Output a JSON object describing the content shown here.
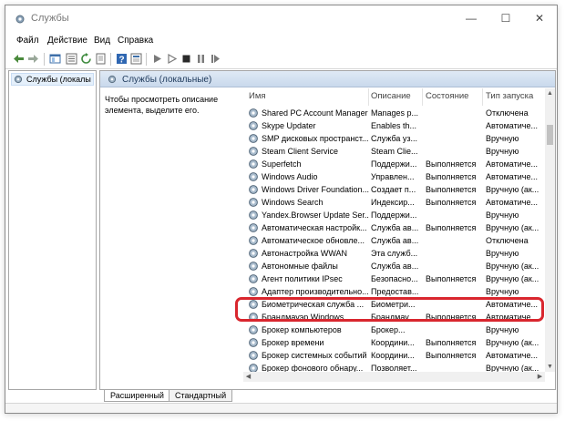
{
  "window": {
    "title": "Службы",
    "controls": {
      "minimize": "—",
      "maximize": "☐",
      "close": "✕"
    }
  },
  "menu": [
    "Файл",
    "Действие",
    "Вид",
    "Справка"
  ],
  "toolbar": {
    "icons": [
      "back-arrow-icon",
      "forward-arrow-icon",
      "console-tree-icon",
      "list-icon",
      "refresh-icon",
      "export-list-icon",
      "help-icon",
      "properties-icon",
      "play-icon",
      "play-outline-icon",
      "stop-icon",
      "pause-icon",
      "restart-icon"
    ]
  },
  "tree": {
    "item_label": "Службы (локалы"
  },
  "panel": {
    "header": "Службы (локальные)",
    "description": "Чтобы просмотреть описание элемента, выделите его."
  },
  "table": {
    "columns": [
      "Имя",
      "Описание",
      "Состояние",
      "Тип запуска"
    ],
    "rows": [
      {
        "name": "Shared PC Account Manager",
        "desc": "Manages p...",
        "state": "",
        "start": "Отключена"
      },
      {
        "name": "Skype Updater",
        "desc": "Enables th...",
        "state": "",
        "start": "Автоматиче..."
      },
      {
        "name": "SMP дисковых пространст...",
        "desc": "Служба уз...",
        "state": "",
        "start": "Вручную"
      },
      {
        "name": "Steam Client Service",
        "desc": "Steam Clie...",
        "state": "",
        "start": "Вручную"
      },
      {
        "name": "Superfetch",
        "desc": "Поддержи...",
        "state": "Выполняется",
        "start": "Автоматиче..."
      },
      {
        "name": "Windows Audio",
        "desc": "Управлен...",
        "state": "Выполняется",
        "start": "Автоматиче..."
      },
      {
        "name": "Windows Driver Foundation...",
        "desc": "Создает п...",
        "state": "Выполняется",
        "start": "Вручную (ак..."
      },
      {
        "name": "Windows Search",
        "desc": "Индексир...",
        "state": "Выполняется",
        "start": "Автоматиче..."
      },
      {
        "name": "Yandex.Browser Update Ser...",
        "desc": "Поддержи...",
        "state": "",
        "start": "Вручную"
      },
      {
        "name": "Автоматическая настройк...",
        "desc": "Служба ав...",
        "state": "Выполняется",
        "start": "Вручную (ак..."
      },
      {
        "name": "Автоматическое обновле...",
        "desc": "Служба ав...",
        "state": "",
        "start": "Отключена"
      },
      {
        "name": "Автонастройка WWAN",
        "desc": "Эта служб...",
        "state": "",
        "start": "Вручную"
      },
      {
        "name": "Автономные файлы",
        "desc": "Служба ав...",
        "state": "",
        "start": "Вручную (ак..."
      },
      {
        "name": "Агент политики IPsec",
        "desc": "Безопасно...",
        "state": "Выполняется",
        "start": "Вручную (ак..."
      },
      {
        "name": "Адаптер производительно...",
        "desc": "Предостав...",
        "state": "",
        "start": "Вручную"
      },
      {
        "name": "Биометрическая служба ...",
        "desc": "Биометри...",
        "state": "",
        "start": "Автоматиче..."
      },
      {
        "name": "Брандмауэр Windows",
        "desc": "Брандмау...",
        "state": "Выполняется",
        "start": "Автоматиче..."
      },
      {
        "name": "Брокер компьютеров",
        "desc": "Брокер...",
        "state": "",
        "start": "Вручную"
      },
      {
        "name": "Брокер времени",
        "desc": "Координи...",
        "state": "Выполняется",
        "start": "Вручную (ак..."
      },
      {
        "name": "Брокер системных событий",
        "desc": "Координи...",
        "state": "Выполняется",
        "start": "Автоматиче..."
      },
      {
        "name": "Брокер фонового обнару...",
        "desc": "Позволяет...",
        "state": "",
        "start": "Вручную (ак..."
      }
    ]
  },
  "tabs": [
    "Расширенный",
    "Стандартный"
  ],
  "colors": {
    "highlight": "#d9262e",
    "header_text": "#1e395b",
    "selection": "#e5f0fb"
  }
}
